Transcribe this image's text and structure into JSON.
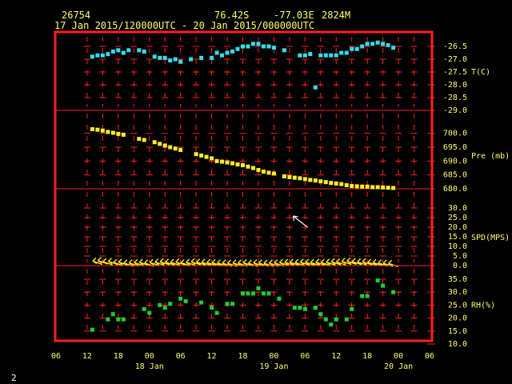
{
  "header": {
    "station_id": "26754",
    "lat": "76.42S",
    "lon": "-77.03E",
    "elev": "2824M",
    "period": "17 Jan 2015/120000UTC - 20 Jan 2015/000000UTC"
  },
  "footer": {
    "frame": "2"
  },
  "colors": {
    "background": "#000000",
    "frame": "#ff2020",
    "grid": "#ff2020",
    "labels": "#ffff66",
    "temp": "#33ddee",
    "pressure": "#ffee22",
    "wind": "#ffee22",
    "rh": "#22cc33"
  },
  "chart_data": {
    "type": "scatter",
    "x_unit": "hours since 17 Jan 2015 06 UTC",
    "x_range": [
      0,
      72
    ],
    "x_ticks": [
      "06",
      "12",
      "18",
      "00",
      "06",
      "12",
      "18",
      "00",
      "06",
      "12",
      "18",
      "00",
      "06"
    ],
    "date_labels": [
      {
        "text": "18 Jan",
        "x": 18
      },
      {
        "text": "19 Jan",
        "x": 42
      },
      {
        "text": "20 Jan",
        "x": 66
      }
    ],
    "panels": [
      {
        "name": "T(C)",
        "type": "scatter",
        "ylim": [
          -29.0,
          -26.5
        ],
        "ticks": [
          "-26.5",
          "-27.0",
          "-27.5",
          "-28.0",
          "-28.5",
          "-29.0"
        ],
        "tick_values": [
          -26.5,
          -27.0,
          -27.5,
          -28.0,
          -28.5,
          -29.0
        ],
        "points": [
          [
            7,
            -26.9
          ],
          [
            8,
            -26.85
          ],
          [
            9,
            -26.85
          ],
          [
            10,
            -26.8
          ],
          [
            11,
            -26.7
          ],
          [
            12,
            -26.65
          ],
          [
            13,
            -26.75
          ],
          [
            14,
            -26.65
          ],
          [
            16,
            -26.65
          ],
          [
            17,
            -26.7
          ],
          [
            19,
            -26.9
          ],
          [
            20,
            -26.95
          ],
          [
            21,
            -26.95
          ],
          [
            22,
            -27.05
          ],
          [
            23,
            -27.0
          ],
          [
            24,
            -27.1
          ],
          [
            26,
            -27.0
          ],
          [
            28,
            -26.95
          ],
          [
            30,
            -26.95
          ],
          [
            31,
            -26.75
          ],
          [
            32,
            -26.85
          ],
          [
            33,
            -26.75
          ],
          [
            34,
            -26.7
          ],
          [
            35,
            -26.6
          ],
          [
            36,
            -26.5
          ],
          [
            37,
            -26.5
          ],
          [
            38,
            -26.4
          ],
          [
            39,
            -26.4
          ],
          [
            40,
            -26.5
          ],
          [
            41,
            -26.5
          ],
          [
            42,
            -26.55
          ],
          [
            44,
            -26.65
          ],
          [
            47,
            -26.85
          ],
          [
            48,
            -26.85
          ],
          [
            49,
            -26.8
          ],
          [
            50,
            -28.1
          ],
          [
            51,
            -26.85
          ],
          [
            52,
            -26.85
          ],
          [
            53,
            -26.85
          ],
          [
            54,
            -26.85
          ],
          [
            55,
            -26.75
          ],
          [
            56,
            -26.75
          ],
          [
            57,
            -26.6
          ],
          [
            58,
            -26.6
          ],
          [
            59,
            -26.5
          ],
          [
            60,
            -26.4
          ],
          [
            61,
            -26.4
          ],
          [
            62,
            -26.35
          ],
          [
            63,
            -26.4
          ],
          [
            64,
            -26.45
          ],
          [
            65,
            -26.55
          ]
        ]
      },
      {
        "name": "Pre (mb)",
        "type": "scatter",
        "ylim": [
          680.0,
          702.5
        ],
        "ticks": [
          "700.0",
          "695.0",
          "690.0",
          "685.0",
          "680.0"
        ],
        "tick_values": [
          700.0,
          695.0,
          690.0,
          685.0,
          680.0
        ],
        "points": [
          [
            7,
            701.5
          ],
          [
            8,
            701.3
          ],
          [
            9,
            701.0
          ],
          [
            10,
            700.5
          ],
          [
            11,
            700.2
          ],
          [
            12,
            699.8
          ],
          [
            13,
            699.5
          ],
          [
            16,
            698.0
          ],
          [
            17,
            697.6
          ],
          [
            19,
            696.8
          ],
          [
            20,
            696.2
          ],
          [
            21,
            695.6
          ],
          [
            22,
            695.0
          ],
          [
            23,
            694.5
          ],
          [
            24,
            694.0
          ],
          [
            27,
            692.5
          ],
          [
            28,
            692.0
          ],
          [
            29,
            691.5
          ],
          [
            30,
            691.0
          ],
          [
            31,
            690.0
          ],
          [
            32,
            689.8
          ],
          [
            33,
            689.5
          ],
          [
            34,
            689.2
          ],
          [
            35,
            688.8
          ],
          [
            36,
            688.5
          ],
          [
            37,
            688.0
          ],
          [
            38,
            687.5
          ],
          [
            39,
            686.8
          ],
          [
            40,
            686.2
          ],
          [
            41,
            685.8
          ],
          [
            42,
            685.5
          ],
          [
            44,
            684.5
          ],
          [
            45,
            684.2
          ],
          [
            46,
            684.0
          ],
          [
            47,
            683.8
          ],
          [
            48,
            683.5
          ],
          [
            49,
            683.2
          ],
          [
            50,
            683.0
          ],
          [
            51,
            682.7
          ],
          [
            52,
            682.4
          ],
          [
            53,
            682.1
          ],
          [
            54,
            681.9
          ],
          [
            55,
            681.7
          ],
          [
            56,
            681.3
          ],
          [
            57,
            681.0
          ],
          [
            58,
            680.9
          ],
          [
            59,
            680.8
          ],
          [
            60,
            680.8
          ],
          [
            61,
            680.6
          ],
          [
            62,
            680.6
          ],
          [
            63,
            680.5
          ],
          [
            64,
            680.4
          ],
          [
            65,
            680.3
          ]
        ]
      },
      {
        "name": "SPD(MPS)",
        "type": "wind-vectors",
        "ylim": [
          0.0,
          30.0
        ],
        "ticks": [
          "30.0",
          "25.0",
          "20.0",
          "15.0",
          "10.0",
          "5.0",
          "0.0"
        ],
        "tick_values": [
          30,
          25,
          20,
          15,
          10,
          5,
          0
        ],
        "points": [
          [
            8,
            1.5,
            1
          ],
          [
            9,
            1.8,
            1
          ],
          [
            10,
            1.2,
            1
          ],
          [
            11,
            1.4,
            1
          ],
          [
            12,
            0.8,
            1
          ],
          [
            13,
            1.0,
            1
          ],
          [
            14,
            0.5,
            1
          ],
          [
            15,
            0.6,
            1
          ],
          [
            16,
            0.7,
            1
          ],
          [
            17,
            0.9,
            1
          ],
          [
            18,
            0.5,
            1
          ],
          [
            19,
            0.8,
            1
          ],
          [
            20,
            1.0,
            1
          ],
          [
            21,
            1.2,
            1
          ],
          [
            22,
            1.0,
            1
          ],
          [
            23,
            0.9,
            1
          ],
          [
            24,
            1.1,
            1
          ],
          [
            25,
            0.7,
            1
          ],
          [
            26,
            0.9,
            1
          ],
          [
            27,
            1.2,
            1
          ],
          [
            28,
            1.0,
            1
          ],
          [
            29,
            0.9,
            1
          ],
          [
            30,
            0.8,
            1
          ],
          [
            31,
            0.7,
            1
          ],
          [
            32,
            0.6,
            1
          ],
          [
            33,
            0.5,
            1
          ],
          [
            34,
            0.4,
            1
          ],
          [
            35,
            0.6,
            1
          ],
          [
            36,
            0.5,
            1
          ],
          [
            37,
            0.7,
            1
          ],
          [
            38,
            0.4,
            1
          ],
          [
            39,
            0.6,
            1
          ],
          [
            40,
            0.5,
            1
          ],
          [
            41,
            0.4,
            1
          ],
          [
            42,
            0.5,
            1
          ],
          [
            43,
            0.6,
            1
          ],
          [
            44,
            0.8,
            1
          ],
          [
            45,
            0.9,
            1
          ],
          [
            46,
            0.9,
            1
          ],
          [
            47,
            0.8,
            1
          ],
          [
            48,
            1.0,
            1
          ],
          [
            49,
            0.9,
            1
          ],
          [
            50,
            0.8,
            1
          ],
          [
            51,
            0.9,
            1
          ],
          [
            52,
            0.8,
            1
          ],
          [
            53,
            1.0,
            1
          ],
          [
            54,
            1.2,
            1
          ],
          [
            55,
            1.1,
            1
          ],
          [
            56,
            1.4,
            1
          ],
          [
            57,
            1.5,
            1
          ],
          [
            58,
            1.3,
            1
          ],
          [
            59,
            1.1,
            1
          ],
          [
            60,
            1.2,
            1
          ],
          [
            61,
            0.9,
            1
          ],
          [
            62,
            0.8,
            1
          ],
          [
            63,
            0.6,
            1
          ],
          [
            64,
            0.4,
            1
          ],
          [
            65,
            0.3,
            1
          ]
        ]
      },
      {
        "name": "RH(%)",
        "type": "scatter",
        "ylim": [
          10.0,
          35.0
        ],
        "ticks": [
          "35.0",
          "30.0",
          "25.0",
          "20.0",
          "15.0",
          "10.0"
        ],
        "tick_values": [
          35,
          30,
          25,
          20,
          15,
          10
        ],
        "points": [
          [
            7,
            15.5
          ],
          [
            10,
            19.5
          ],
          [
            11,
            21.5
          ],
          [
            12,
            19.5
          ],
          [
            13,
            19.5
          ],
          [
            17,
            23.5
          ],
          [
            18,
            22.0
          ],
          [
            20,
            25.0
          ],
          [
            21,
            24.0
          ],
          [
            22,
            25.5
          ],
          [
            24,
            27.5
          ],
          [
            25,
            26.5
          ],
          [
            28,
            26.0
          ],
          [
            30,
            24.0
          ],
          [
            31,
            22.0
          ],
          [
            33,
            25.5
          ],
          [
            34,
            25.5
          ],
          [
            36,
            29.5
          ],
          [
            37,
            29.5
          ],
          [
            38,
            29.5
          ],
          [
            39,
            31.5
          ],
          [
            40,
            29.5
          ],
          [
            41,
            29.5
          ],
          [
            43,
            27.5
          ],
          [
            46,
            24.0
          ],
          [
            47,
            24.0
          ],
          [
            48,
            23.5
          ],
          [
            50,
            24.0
          ],
          [
            51,
            21.5
          ],
          [
            52,
            19.5
          ],
          [
            53,
            17.5
          ],
          [
            54,
            19.5
          ],
          [
            56,
            19.5
          ],
          [
            57,
            23.5
          ],
          [
            59,
            28.5
          ],
          [
            60,
            28.5
          ],
          [
            62,
            34.5
          ],
          [
            63,
            32.5
          ],
          [
            65,
            30.0
          ]
        ]
      }
    ],
    "wind_annotation": {
      "text": "←",
      "x": 44,
      "speed": 27.5
    }
  }
}
